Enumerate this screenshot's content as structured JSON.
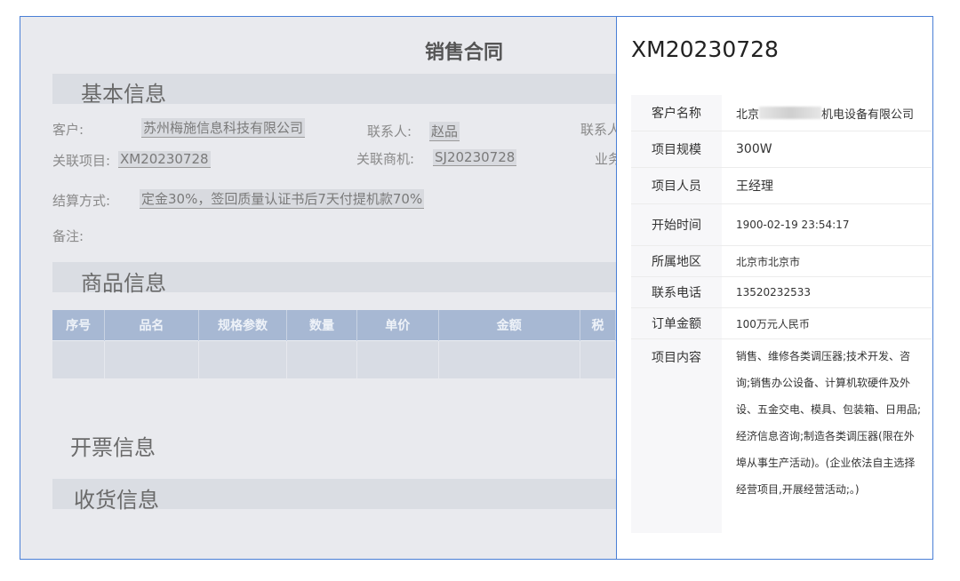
{
  "contract": {
    "title": "销售合同",
    "basic_section": "基本信息",
    "customer_label": "客户:",
    "customer_value": "苏州梅施信息科技有限公司",
    "contact_label": "联系人:",
    "contact_value": "赵品",
    "contact_phone_label_cut": "联系人",
    "project_label": "关联项目:",
    "project_value": "XM20230728",
    "opportunity_label": "关联商机:",
    "opportunity_value": "SJ20230728",
    "business_label_cut": "业务",
    "settlement_label": "结算方式:",
    "settlement_value": "定金30%，签回质量认证书后7天付提机款70%",
    "remark_label": "备注:",
    "goods_section": "商品信息",
    "goods_columns": [
      "序号",
      "品名",
      "规格参数",
      "数量",
      "单价",
      "金额",
      "税"
    ],
    "invoice_section": "开票信息",
    "receipt_section": "收货信息"
  },
  "panel": {
    "title": "XM20230728",
    "rows": [
      {
        "key": "客户名称",
        "val_pre": "北京",
        "val_post": "机电设备有限公司"
      },
      {
        "key": "项目规模",
        "val": "300W"
      },
      {
        "key": "项目人员",
        "val": "王经理"
      },
      {
        "key": "开始时间",
        "val": "1900-02-19 23:54:17"
      },
      {
        "key": "所属地区",
        "val": "北京市北京市"
      },
      {
        "key": "联系电话",
        "val": "13520232533"
      },
      {
        "key": "订单金额",
        "val": "100万元人民币"
      },
      {
        "key": "项目内容",
        "val": "销售、维修各类调压器;技术开发、咨询;销售办公设备、计算机软硬件及外设、五金交电、模具、包装箱、日用品;经济信息咨询;制造各类调压器(限在外埠从事生产活动)。(企业依法自主选择经营项目,开展经营活动;。)"
      }
    ]
  }
}
